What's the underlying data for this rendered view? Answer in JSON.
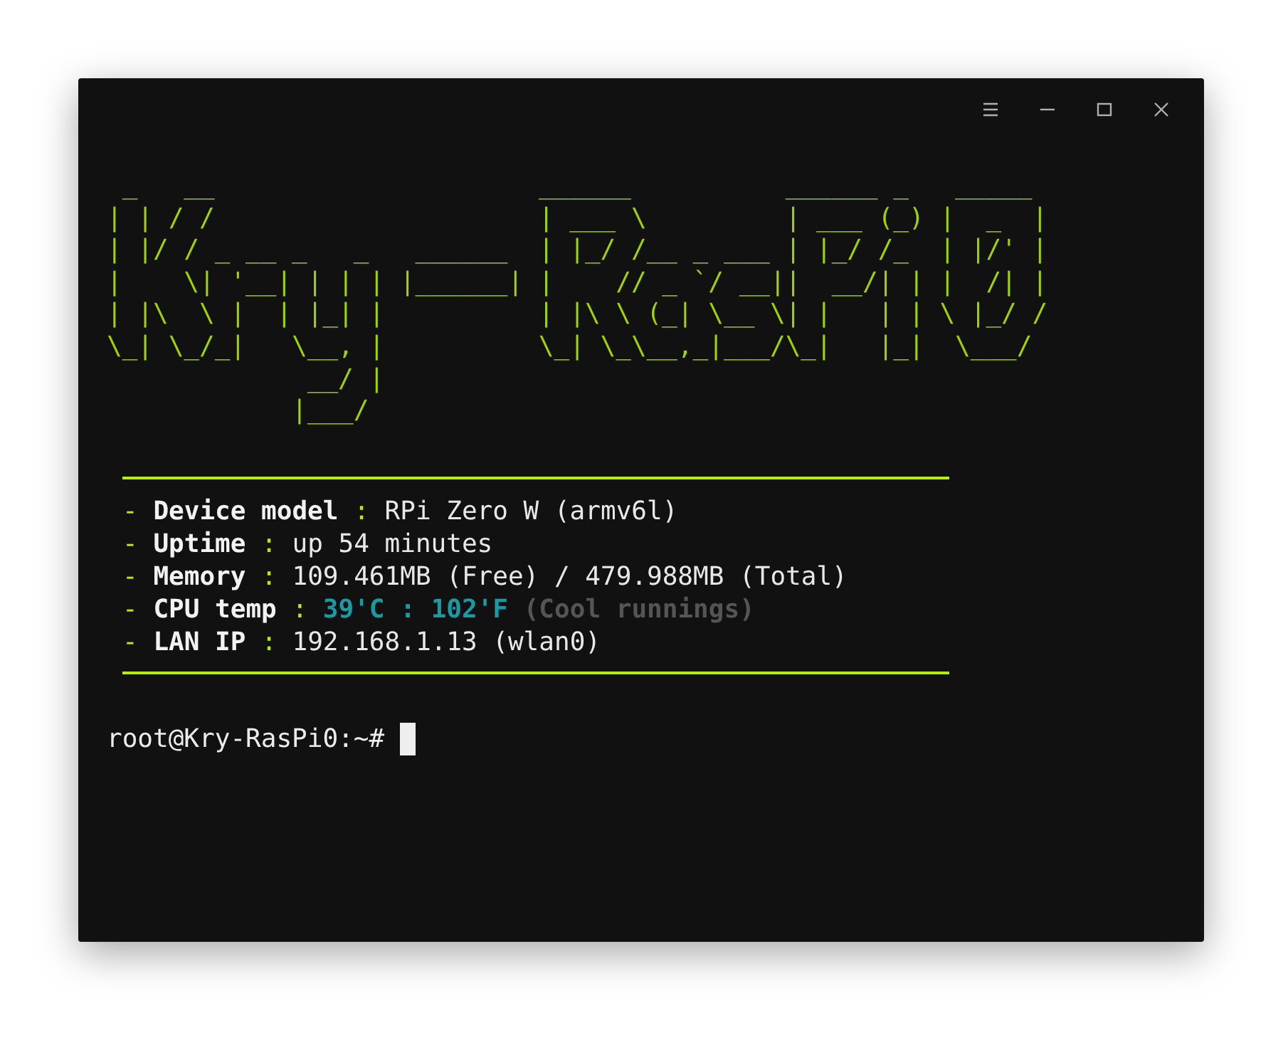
{
  "window": {
    "controls": [
      {
        "kind": "menu"
      },
      {
        "kind": "minimize"
      },
      {
        "kind": "maximize"
      },
      {
        "kind": "close"
      }
    ]
  },
  "banner": {
    "lines": [
      " _   __                     ______          ______ _   _____",
      "| | / /                     | ___ \\         | ___ (_) |  _  |",
      "| |/ / _ __ _   _   ______  | |_/ /__ _ ___ | |_/ /_  | |/' |",
      "|    \\| '__| | | | |______| |    // _ `/ __||  __/| | |  /| |",
      "| |\\  \\ |  | |_| |          | |\\ \\ (_| \\__ \\| |   | | \\ |_/ /",
      "\\_| \\_/_|   \\__, |          \\_| \\_\\__,_|___/\\_|   |_|  \\___/",
      "             __/ |",
      "            |___/"
    ]
  },
  "info": [
    {
      "kind": "plain",
      "bullet": "-",
      "label": "Device model",
      "sep": ":",
      "value": "RPi Zero W (armv6l)"
    },
    {
      "kind": "plain",
      "bullet": "-",
      "label": "Uptime",
      "sep": ":",
      "value": "up 54 minutes"
    },
    {
      "kind": "plain",
      "bullet": "-",
      "label": "Memory",
      "sep": ":",
      "value": "109.461MB (Free) / 479.988MB (Total)"
    },
    {
      "kind": "temp",
      "bullet": "-",
      "label": "CPU temp",
      "sep": ":",
      "celsius": "39'C",
      "joiner": ":",
      "fahrenheit": "102'F",
      "note": "(Cool runnings)"
    },
    {
      "kind": "plain",
      "bullet": "-",
      "label": "LAN IP",
      "sep": ":",
      "value": "192.168.1.13 (wlan0)"
    }
  ],
  "prompt": {
    "text": "root@Kry-RasPi0:~#",
    "cursor": true
  }
}
